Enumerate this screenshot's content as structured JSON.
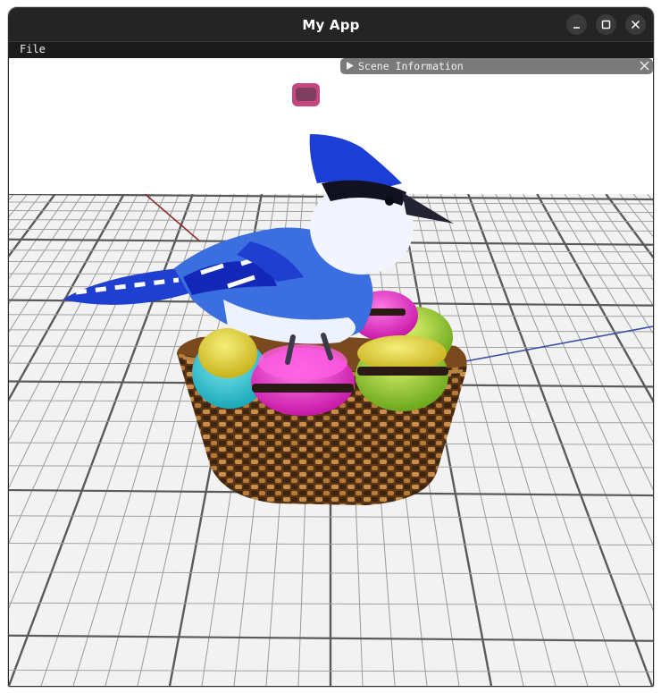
{
  "window": {
    "title": "My App",
    "controls": [
      "minimize-icon",
      "maximize-icon",
      "close-icon"
    ]
  },
  "menubar": {
    "items": [
      {
        "label": "File"
      }
    ]
  },
  "scene_panel": {
    "label": "Scene Information",
    "expand_icon": "triangle-right-icon",
    "close_icon": "close-icon"
  },
  "viewport": {
    "background": "#ffffff",
    "ground_grid": "on",
    "model": "blue jay perched on a wicker basket of colorful macarons"
  },
  "colors": {
    "titlebar": "#242424",
    "menubar": "#1b1b1b",
    "panel": "#7a7a7a",
    "bird_blue": "#1f3fd0",
    "basket": "#7a4a1e"
  }
}
